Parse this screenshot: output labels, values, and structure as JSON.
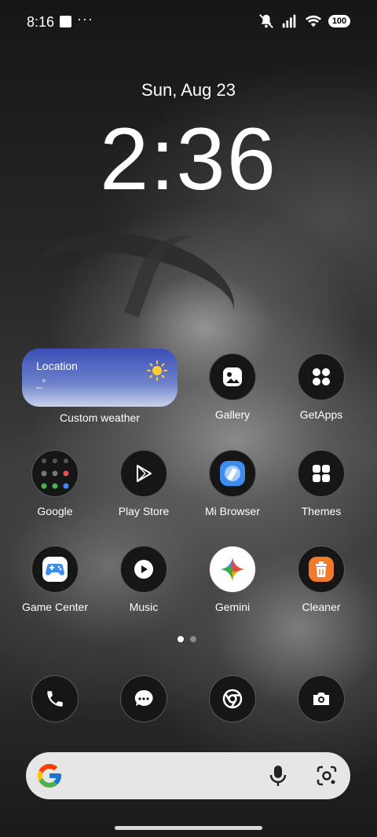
{
  "status_bar": {
    "time": "8:16",
    "more": "···",
    "battery": "100"
  },
  "lock": {
    "date": "Sun, Aug 23",
    "clock": "2:36"
  },
  "weather": {
    "location": "Location",
    "temp": "_°",
    "label": "Custom weather",
    "icon": "sun-icon"
  },
  "apps": {
    "gallery": "Gallery",
    "getapps": "GetApps",
    "google": "Google",
    "playstore": "Play Store",
    "mibrowser": "Mi Browser",
    "themes": "Themes",
    "gamecenter": "Game Center",
    "music": "Music",
    "gemini": "Gemini",
    "cleaner": "Cleaner"
  },
  "dock": [
    "phone-icon",
    "messages-icon",
    "chrome-icon",
    "camera-icon"
  ],
  "page_indicator": {
    "pages": 2,
    "current": 1
  },
  "colors": {
    "weather_widget": "#3a4fb8",
    "cleaner_orange": "#f07a2c",
    "browser_blue": "#3f8cf0",
    "search_bar": "#e6e6e6"
  }
}
